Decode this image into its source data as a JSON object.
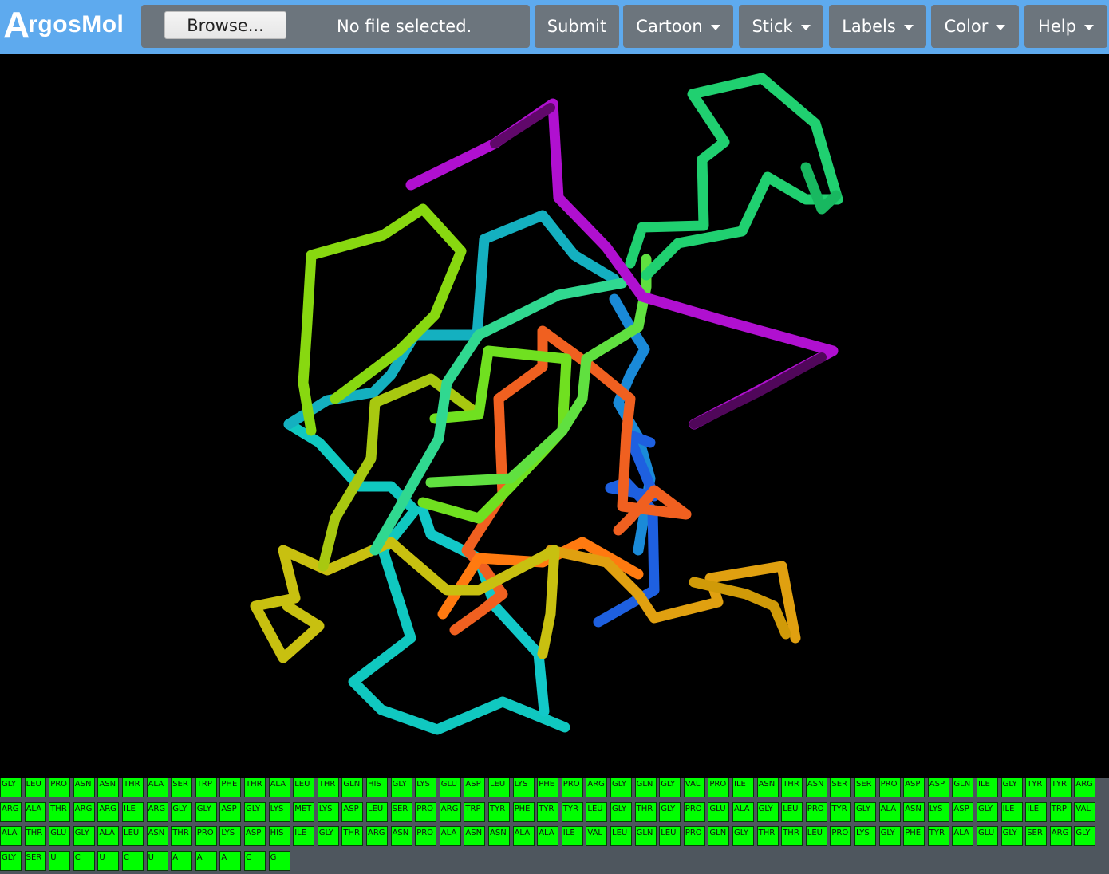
{
  "app": {
    "logo_letter": "A",
    "logo_rest": "rgosMol"
  },
  "toolbar": {
    "browse_label": "Browse...",
    "file_status": "No file selected.",
    "submit_label": "Submit",
    "menus": [
      "Cartoon",
      "Stick",
      "Labels",
      "Color",
      "Help"
    ]
  },
  "colors": {
    "header": "#5eaaee",
    "toolbar_button": "#6c757d",
    "residue_tile": "#00ff00",
    "viewer_background": "#000000"
  },
  "viewer": {
    "representation": "backbone trace, rainbow coloring"
  },
  "sequence": {
    "rows": [
      [
        "GLY",
        "LEU",
        "PRO",
        "ASN",
        "ASN",
        "THR",
        "ALA",
        "SER",
        "TRP",
        "PHE",
        "THR",
        "ALA",
        "LEU",
        "THR",
        "GLN",
        "HIS",
        "GLY",
        "LYS",
        "GLU",
        "ASP",
        "LEU",
        "LYS",
        "PHE",
        "PRO",
        "ARG",
        "GLY",
        "GLN",
        "GLY",
        "VAL",
        "PRO",
        "ILE",
        "ASN",
        "THR",
        "ASN",
        "SER",
        "SER",
        "PRO",
        "ASP",
        "ASP",
        "GLN",
        "ILE",
        "GLY",
        "TYR",
        "TYR",
        "ARG"
      ],
      [
        "ARG",
        "ALA",
        "THR",
        "ARG",
        "ARG",
        "ILE",
        "ARG",
        "GLY",
        "GLY",
        "ASP",
        "GLY",
        "LYS",
        "MET",
        "LYS",
        "ASP",
        "LEU",
        "SER",
        "PRO",
        "ARG",
        "TRP",
        "TYR",
        "PHE",
        "TYR",
        "TYR",
        "LEU",
        "GLY",
        "THR",
        "GLY",
        "PRO",
        "GLU",
        "ALA",
        "GLY",
        "LEU",
        "PRO",
        "TYR",
        "GLY",
        "ALA",
        "ASN",
        "LYS",
        "ASP",
        "GLY",
        "ILE",
        "ILE",
        "TRP",
        "VAL"
      ],
      [
        "ALA",
        "THR",
        "GLU",
        "GLY",
        "ALA",
        "LEU",
        "ASN",
        "THR",
        "PRO",
        "LYS",
        "ASP",
        "HIS",
        "ILE",
        "GLY",
        "THR",
        "ARG",
        "ASN",
        "PRO",
        "ALA",
        "ASN",
        "ASN",
        "ALA",
        "ALA",
        "ILE",
        "VAL",
        "LEU",
        "GLN",
        "LEU",
        "PRO",
        "GLN",
        "GLY",
        "THR",
        "THR",
        "LEU",
        "PRO",
        "LYS",
        "GLY",
        "PHE",
        "TYR",
        "ALA",
        "GLU",
        "GLY",
        "SER",
        "ARG",
        "GLY"
      ],
      [
        "GLY",
        "SER",
        "U",
        "C",
        "U",
        "C",
        "U",
        "A",
        "A",
        "A",
        "C",
        "G"
      ]
    ]
  }
}
